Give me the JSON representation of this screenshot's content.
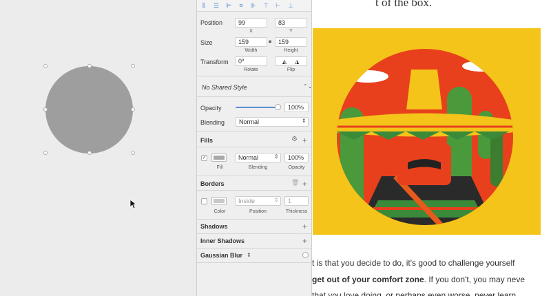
{
  "canvas": {
    "shape": "oval"
  },
  "toolbar": {
    "icons": [
      "distribute-horizontal-icon",
      "distribute-vertical-icon",
      "align-left-icon",
      "align-center-icon",
      "align-right-icon",
      "align-top-icon",
      "align-middle-icon",
      "align-bottom-icon"
    ]
  },
  "position": {
    "label": "Position",
    "x": "99",
    "y": "83",
    "x_label": "X",
    "y_label": "Y"
  },
  "size": {
    "label": "Size",
    "width": "159",
    "height": "159",
    "width_label": "Width",
    "height_label": "Height"
  },
  "transform": {
    "label": "Transform",
    "rotate": "0º",
    "rotate_label": "Rotate",
    "flip_label": "Flip"
  },
  "shared_style": {
    "value": "No Shared Style"
  },
  "opacity": {
    "label": "Opacity",
    "value": "100%",
    "level": 1.0
  },
  "blending": {
    "label": "Blending",
    "value": "Normal"
  },
  "fills": {
    "title": "Fills",
    "blend": "Normal",
    "opacity": "100%",
    "fill_label": "Fill",
    "blending_label": "Blending",
    "opacity_label": "Opacity",
    "color": "#a8a8a8"
  },
  "borders": {
    "title": "Borders",
    "position": "Inside",
    "thickness": "1",
    "color_label": "Color",
    "position_label": "Position",
    "thickness_label": "Thickness"
  },
  "shadows": {
    "title": "Shadows"
  },
  "inner_shadows": {
    "title": "Inner Shadows"
  },
  "gaussian_blur": {
    "title": "Gaussian Blur"
  },
  "article": {
    "heading_fragment": "t of the box.",
    "line1": "t is that you decide to do, it's good to challenge yourself",
    "line2_bold": "get out of your comfort zone",
    "line2_rest": ". If you don't, you may neve",
    "line3": "that you love doing, or perhaps even worse, never learn"
  }
}
